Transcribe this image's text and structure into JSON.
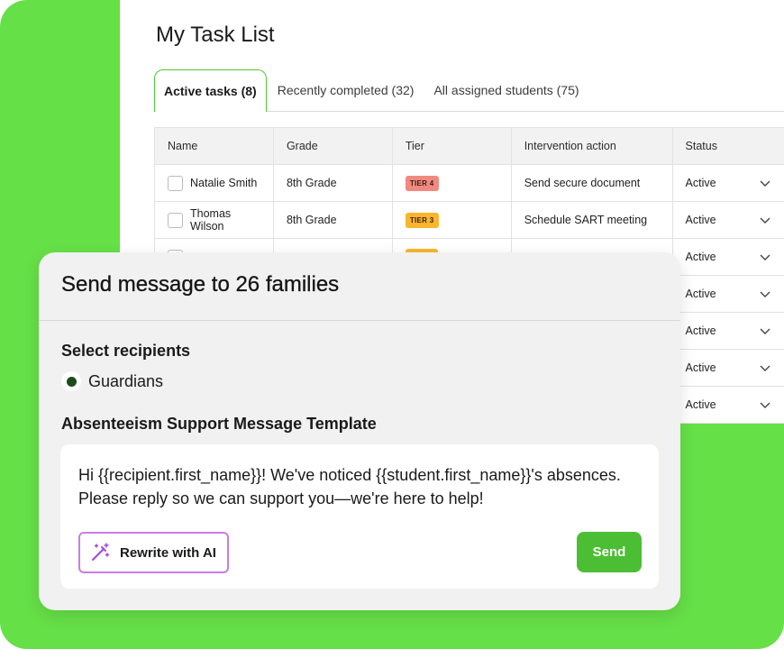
{
  "page": {
    "title": "My Task List",
    "tabs": [
      {
        "label": "Active tasks (8)",
        "active": true
      },
      {
        "label": "Recently completed (32)",
        "active": false
      },
      {
        "label": "All assigned students (75)",
        "active": false
      }
    ]
  },
  "table": {
    "columns": [
      "Name",
      "Grade",
      "Tier",
      "Intervention action",
      "Status"
    ],
    "rows": [
      {
        "name": "Natalie Smith",
        "grade": "8th Grade",
        "tier": "TIER 4",
        "tier_color": "#f08a80",
        "action": "Send secure document",
        "status": "Active"
      },
      {
        "name": "Thomas Wilson",
        "grade": "8th Grade",
        "tier": "TIER 3",
        "tier_color": "#f9b52e",
        "action": "Schedule SART meeting",
        "status": "Active"
      },
      {
        "status": "Active"
      },
      {
        "status": "Active"
      },
      {
        "status": "Active"
      },
      {
        "status": "Active"
      },
      {
        "status": "Active"
      }
    ]
  },
  "modal": {
    "title": "Send message to 26 families",
    "recipients_label": "Select recipients",
    "recipient_option": "Guardians",
    "template_label": "Absenteeism Support Message Template",
    "message": "Hi {{recipient.first_name}}! We've noticed {{student.first_name}}'s absences. Please reply so we can support you—we're here to help!",
    "rewrite_label": "Rewrite with AI",
    "send_label": "Send"
  },
  "colors": {
    "brand_green": "#66e047",
    "send_green": "#4cbe34",
    "ai_purple": "#c77de8",
    "tier_3": "#f9b52e",
    "tier_4": "#f08a80"
  },
  "icons": {
    "status_toggle": "chevron-down-icon",
    "rewrite": "magic-wand-icon"
  }
}
